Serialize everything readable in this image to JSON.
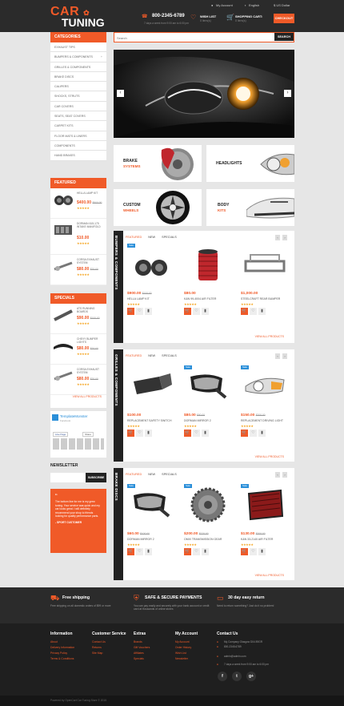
{
  "header": {
    "logo_top": "CAR",
    "logo_bottom": "TUNING",
    "my_account": "My Account",
    "language": "English",
    "currency": "$ US Dollar",
    "phone": "800-2345-6789",
    "phone_sub": "7 days a week from 9:00 am to 6:00 pm",
    "wishlist_label": "WISH LIST",
    "wishlist_value": "0 item(s)",
    "cart_label": "SHOPPING CART:",
    "cart_value": "0 item(s)",
    "checkout": "CHECKOUT"
  },
  "search": {
    "placeholder": "Search",
    "button": "SEARCH"
  },
  "categories": {
    "title": "CATEGORIES",
    "items": [
      "EXHAUST TIPS",
      "BUMPERS & COMPONENTS",
      "GRILLES & COMPONENTS",
      "BRAKE DISCS",
      "CALIPERS",
      "SHOCKS, STRUTS",
      "CAR COVERS",
      "SEATS, SEAT COVERS",
      "CARPET KITS",
      "FLOOR MATS & LINERS",
      "COMPONENTS",
      "HAND BRAKES"
    ],
    "plus": "+"
  },
  "featured_side": {
    "title": "FEATURED",
    "items": [
      {
        "name": "HELLA LAMP KIT",
        "price": "$400.00",
        "old": "$500.00"
      },
      {
        "name": "DORMAN 615-175 INTAKE MANIFOLD",
        "price": "$10.00",
        "old": ""
      },
      {
        "name": "CORSA EXHAUST SYSTEM",
        "price": "$80.00",
        "old": "$20.00"
      }
    ]
  },
  "specials_side": {
    "title": "SPECIALS",
    "items": [
      {
        "name": "ATS RUNNING BOARDS",
        "price": "$90.00",
        "old": "$100.00"
      },
      {
        "name": "CHEVY BUMPER LIGHTS",
        "price": "$80.00",
        "old": "$20.00"
      },
      {
        "name": "CORSA EXHAUST SYSTEM",
        "price": "$80.00",
        "old": "$20.00"
      }
    ],
    "view_all": "VIEW ALL PRODUCTS"
  },
  "template_monster": {
    "name": "TemplateMonster",
    "sub": "Facebook",
    "like": "Like Page",
    "share": "Share"
  },
  "newsletter": {
    "title": "NEWSLETTER",
    "button": "SUBSCRIBE"
  },
  "testimonial": {
    "quote": "The bottom line for me is my grew tuning. Your service was quick and my car looks great. I will definitely recommend your shop to friends looking for quality performance parts.",
    "author": "- SPORT CUSTOMER"
  },
  "banners": [
    {
      "line1": "BRAKE",
      "line2": "SYSTEMS"
    },
    {
      "line1": "HEADLIGHTS",
      "line2": ""
    },
    {
      "line1": "CUSTOM",
      "line2": "WHEELS"
    },
    {
      "line1": "BODY",
      "line2": "KITS"
    }
  ],
  "tabs": [
    "FEATURED",
    "NEW",
    "SPECIALS"
  ],
  "sections": [
    {
      "title": "BUMPERS & COMPONENTS",
      "products": [
        {
          "price": "$900.00",
          "old": "$100.00",
          "name": "HELLA LAMP KIT",
          "sale": "Sale"
        },
        {
          "price": "$80.00",
          "old": "",
          "name": "K&N 99-4004 AIR FILTER",
          "sale": ""
        },
        {
          "price": "$1,000.00",
          "old": "",
          "name": "STEELCRAFT REAR BUMPER",
          "sale": ""
        }
      ],
      "view_all": "VIEW ALL PRODUCTS"
    },
    {
      "title": "GRILLES & COMPONENTS",
      "products": [
        {
          "price": "$100.00",
          "old": "",
          "name": "REPLACEMENT SAFETY SWITCH",
          "sale": ""
        },
        {
          "price": "$80.00",
          "old": "$90.00",
          "name": "DORMAN MIRROR 2",
          "sale": "Sale"
        },
        {
          "price": "$150.00",
          "old": "$200.00",
          "name": "REPLACEMENT DRIVING LIGHT",
          "sale": "Sale"
        }
      ],
      "view_all": "VIEW ALL PRODUCTS"
    },
    {
      "title": "BRAKE DISCS",
      "products": [
        {
          "price": "$60.00",
          "old": "$100.00",
          "name": "DORMAN MIRROR 2",
          "sale": "Sale"
        },
        {
          "price": "$200.00",
          "old": "$270.00",
          "name": "OMIX TRANSMISSION GEAR",
          "sale": "Sale"
        },
        {
          "price": "$130.00",
          "old": "$200.00",
          "name": "K&N 33-2140 AIR FILTER",
          "sale": "Sale"
        }
      ],
      "view_all": "VIEW ALL PRODUCTS"
    }
  ],
  "features": [
    {
      "title": "Free shipping",
      "sub": "Free shipping on all domestic orders of $99 or more"
    },
    {
      "title": "SAFE & SECURE PAYMENTS",
      "sub": "You can pay easily and securely with your bank account or credit card at thousands of online stores"
    },
    {
      "title": "30 day easy return",
      "sub": "Need to return something? Just do it no problem!"
    }
  ],
  "footer": {
    "columns": [
      {
        "title": "Information",
        "links": [
          "About",
          "Delivery Information",
          "Privacy Policy",
          "Terms & Conditions"
        ]
      },
      {
        "title": "Customer Service",
        "links": [
          "Contact Us",
          "Returns",
          "Site Map"
        ]
      },
      {
        "title": "Extras",
        "links": [
          "Brands",
          "Gift Vouchers",
          "Affiliates",
          "Specials"
        ]
      },
      {
        "title": "My Account",
        "links": [
          "My Account",
          "Order History",
          "Wish List",
          "Newsletter"
        ]
      }
    ],
    "contact_title": "Contact Us",
    "contact": [
      "My Company Glasgow D04 89GR",
      "800-2345-6789",
      "admin@admin.com",
      "7 days a week from 9:00 am to 6:00 pm"
    ],
    "social": [
      "f",
      "t",
      "g+"
    ],
    "copyright": "Powered by OpenCart Car Tuning Store © 2015"
  },
  "colors": {
    "accent": "#f05a28",
    "dark": "#2b2b2b",
    "sale_badge": "#2b8fd9"
  }
}
